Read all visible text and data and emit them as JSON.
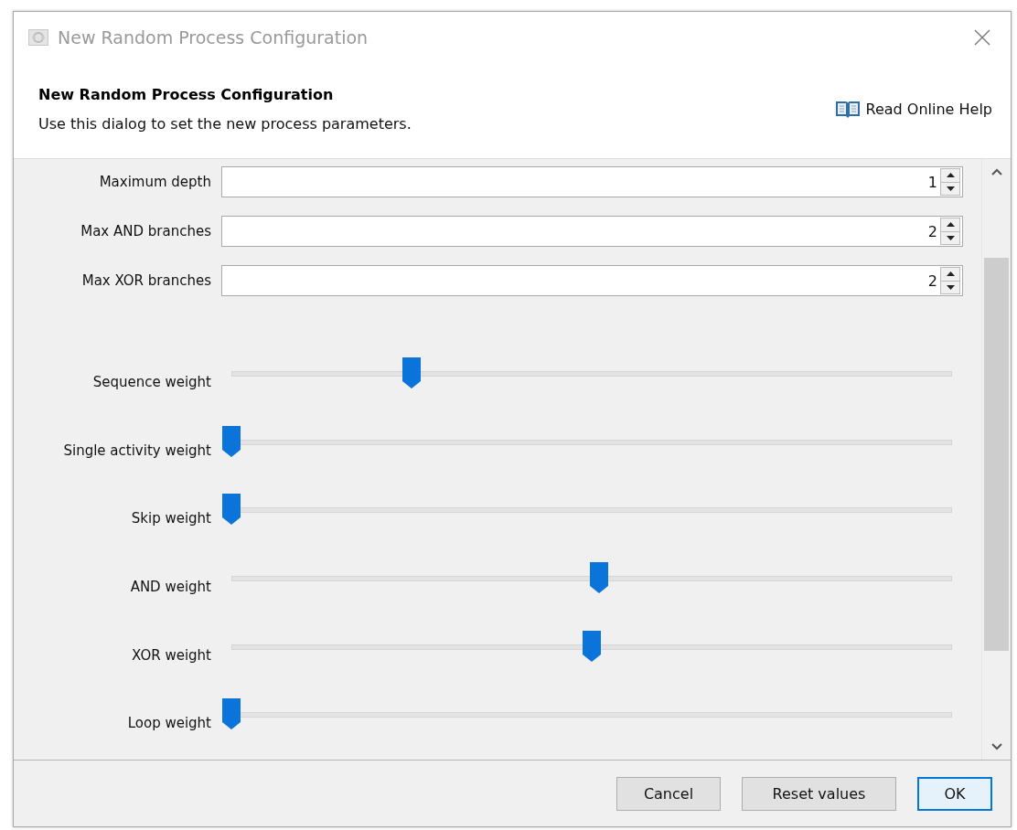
{
  "window": {
    "title": "New Random Process Configuration"
  },
  "header": {
    "title": "New Random Process Configuration",
    "subtitle": "Use this dialog to set the new process parameters.",
    "help_link": "Read Online Help"
  },
  "spinners": [
    {
      "label": "Maximum depth",
      "value": "1"
    },
    {
      "label": "Max AND branches",
      "value": "2"
    },
    {
      "label": "Max XOR branches",
      "value": "2"
    }
  ],
  "sliders": [
    {
      "label": "Sequence weight",
      "level": 0.25
    },
    {
      "label": "Single activity weight",
      "level": 0
    },
    {
      "label": "Skip weight",
      "level": 0
    },
    {
      "label": "AND weight",
      "level": 0.51
    },
    {
      "label": "XOR weight",
      "level": 0.5
    },
    {
      "label": "Loop weight",
      "level": 0
    }
  ],
  "buttons": [
    {
      "label": "Cancel",
      "default": false
    },
    {
      "label": "Reset values",
      "default": false
    },
    {
      "label": "OK",
      "default": true
    }
  ]
}
